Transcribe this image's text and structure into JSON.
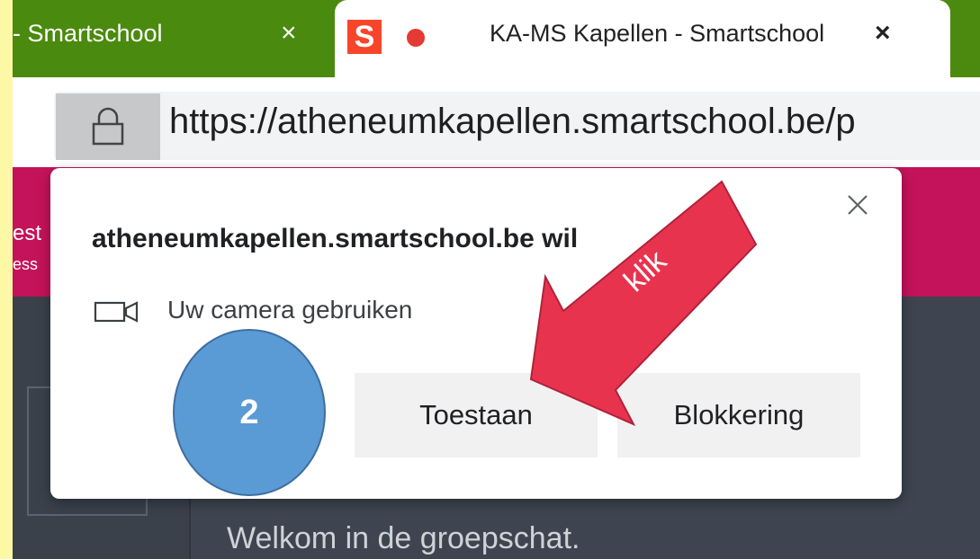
{
  "tabs": [
    {
      "title": "- Smartschool",
      "close": "×"
    },
    {
      "favicon": "S",
      "title": "KA-MS Kapellen - Smartschool",
      "close": "×"
    }
  ],
  "address_bar": {
    "url": "https://atheneumkapellen.smartschool.be/p"
  },
  "page": {
    "header_peek_1": "est",
    "header_peek_2": "ess",
    "welcome_text": "Welkom in de groepschat."
  },
  "permission_dialog": {
    "origin": "atheneumkapellen.smartschool.be wil",
    "permission_label": "Uw camera gebruiken",
    "allow_label": "Toestaan",
    "block_label": "Blokkering"
  },
  "annotations": {
    "step_number": "2",
    "arrow_label": "klik",
    "arrow_color": "#e8334f",
    "badge_color": "#5b9bd5"
  }
}
